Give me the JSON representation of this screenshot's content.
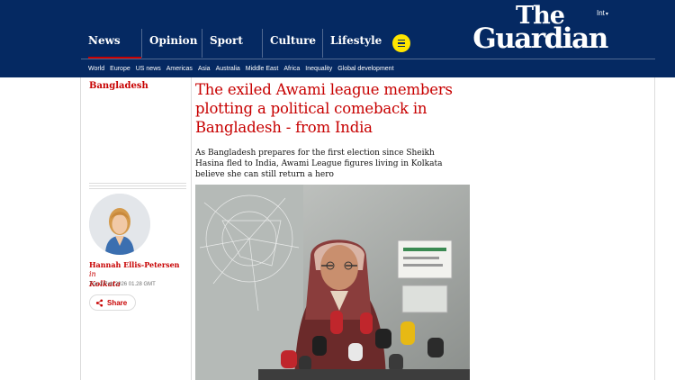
{
  "header": {
    "edition": "Int",
    "logo_line1": "The",
    "logo_line2": "Guardian",
    "pillars": [
      {
        "label": "News"
      },
      {
        "label": "Opinion"
      },
      {
        "label": "Sport"
      },
      {
        "label": "Culture"
      },
      {
        "label": "Lifestyle"
      }
    ],
    "subnav": [
      "World",
      "Europe",
      "US news",
      "Americas",
      "Asia",
      "Australia",
      "Middle East",
      "Africa",
      "Inequality",
      "Global development"
    ]
  },
  "article": {
    "section": "Bangladesh",
    "headline": "The exiled Awami league members plotting a political comeback in Bangladesh - from India",
    "standfirst": "As Bangladesh prepares for the first election since Sheikh Hasina fled to India, Awami League figures living in Kolkata believe she can still return a hero",
    "byline_name": "Hannah Ellis-Petersen",
    "byline_in": "in",
    "byline_location": "Kolkata",
    "timestamp": "Tue 3 Feb 2026 01.28 GMT",
    "share_label": "Share"
  },
  "colors": {
    "brand_blue": "#052962",
    "news_red": "#c70000",
    "menu_yellow": "#ffe500"
  }
}
